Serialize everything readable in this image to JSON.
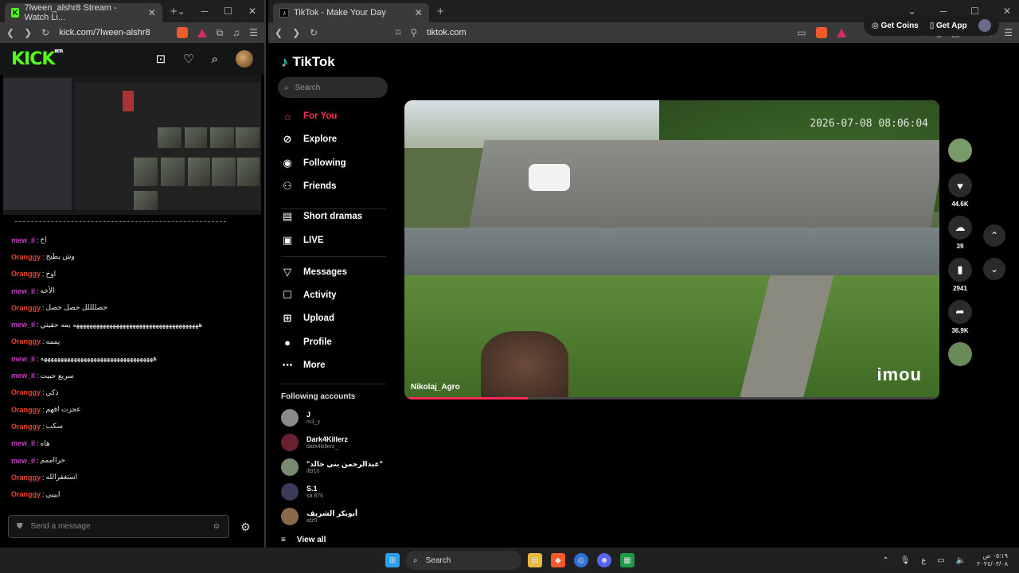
{
  "left_browser": {
    "tab_title": "7lween_alshr8 Stream - Watch Li...",
    "url": "kick.com/7lween-alshr8",
    "kick_logo": "KICK",
    "kick_badge": "BETA",
    "chat_messages": [
      {
        "user": "mew_il",
        "text": "اخ",
        "color": "#c23fbf"
      },
      {
        "user": "Oranggy",
        "text": "وش يطيح",
        "color": "#e8442f"
      },
      {
        "user": "Oranggy",
        "text": "اوخ",
        "color": "#e8442f"
      },
      {
        "user": "mew_il",
        "text": "الأخه",
        "color": "#c23fbf"
      },
      {
        "user": "Oranggy",
        "text": "حصللللل حصل حصل",
        "color": "#e8442f"
      },
      {
        "user": "mew_il",
        "text": "ههههههههههههههههههههههههههههههههههههههه يمه حقيتي",
        "color": "#c23fbf"
      },
      {
        "user": "Oranggy",
        "text": "يممه",
        "color": "#e8442f"
      },
      {
        "user": "mew_il",
        "text": "ههههههههههههههههههههههههههههههههههه",
        "color": "#c23fbf"
      },
      {
        "user": "mew_il",
        "text": "سريع حبيت",
        "color": "#c23fbf"
      },
      {
        "user": "Oranggy",
        "text": "ذكي",
        "color": "#e8442f"
      },
      {
        "user": "Oranggy",
        "text": "عجزت افهم",
        "color": "#e8442f"
      },
      {
        "user": "Oranggy",
        "text": "سكب",
        "color": "#e8442f"
      },
      {
        "user": "mew_il",
        "text": "هاه",
        "color": "#c23fbf"
      },
      {
        "user": "mew_il",
        "text": "حرااممم",
        "color": "#c23fbf"
      },
      {
        "user": "Oranggy",
        "text": "استغفرالله",
        "color": "#e8442f"
      },
      {
        "user": "Oranggy",
        "text": "ايييي",
        "color": "#e8442f"
      }
    ],
    "chat_placeholder": "Send a message"
  },
  "right_browser": {
    "tab_title": "TikTok - Make Your Day",
    "url": "tiktok.com",
    "logo": "TikTok",
    "search_placeholder": "Search",
    "nav": [
      {
        "label": "For You",
        "icon": "home-icon",
        "active": true
      },
      {
        "label": "Explore",
        "icon": "compass-icon"
      },
      {
        "label": "Following",
        "icon": "following-icon"
      },
      {
        "label": "Friends",
        "icon": "friends-icon"
      },
      {
        "label": "Short dramas",
        "icon": "film-icon"
      },
      {
        "label": "LIVE",
        "icon": "tv-icon"
      },
      {
        "label": "Messages",
        "icon": "send-icon"
      },
      {
        "label": "Activity",
        "icon": "bell-icon"
      },
      {
        "label": "Upload",
        "icon": "plus-icon"
      },
      {
        "label": "Profile",
        "icon": "profile-icon"
      },
      {
        "label": "More",
        "icon": "more-icon"
      }
    ],
    "following_title": "Following accounts",
    "following": [
      {
        "name": "J",
        "handle": "m3_y"
      },
      {
        "name": "Dark4Killerz",
        "handle": "dark4killerz_"
      },
      {
        "name": "\"عبدالرحمن بني خالد\"",
        "handle": "ill910"
      },
      {
        "name": "S.1",
        "handle": "sa.876"
      },
      {
        "name": "أبوبكر الشريف",
        "handle": "afz0"
      }
    ],
    "view_all": "View all",
    "get_coins": "Get Coins",
    "get_app": "Get App",
    "video": {
      "timestamp": "2026-07-08 08:06:04",
      "username": "Nikolaj_Agro",
      "brand": "imou",
      "progress": 0.23
    },
    "actions": [
      {
        "icon": "heart-icon",
        "count": "44.6K"
      },
      {
        "icon": "comment-icon",
        "count": "39"
      },
      {
        "icon": "bookmark-icon",
        "count": "2941"
      },
      {
        "icon": "share-icon",
        "count": "36.9K"
      }
    ]
  },
  "taskbar": {
    "search_label": "Search",
    "time": "٠٥:١٩ ص",
    "date": "٢٠٢٤/٠٣/٠٨",
    "lang": "ع"
  }
}
